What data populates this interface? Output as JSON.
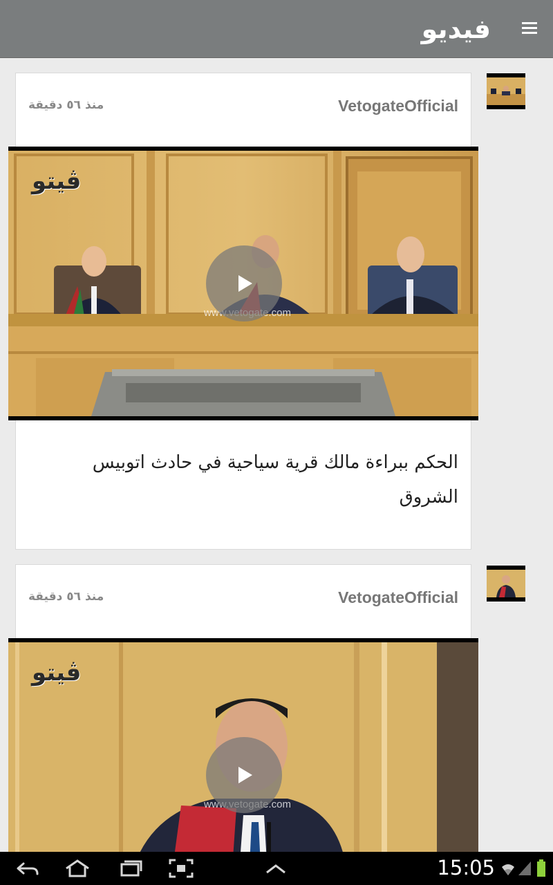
{
  "appbar": {
    "title": "فيديو",
    "menu_icon": "hamburger-icon"
  },
  "feed": {
    "items": [
      {
        "author": "VetogateOfficial",
        "time": "منذ ٥٦ دقيقة",
        "logo_text": "ڤيتو",
        "watermark": "www.vetogate.com",
        "caption_lines": [
          "الحكم ببراءة مالك قرية سياحية في حادث اتوبيس",
          "الشروق"
        ]
      },
      {
        "author": "VetogateOfficial",
        "time": "منذ ٥٦ دقيقة",
        "logo_text": "ڤيتو",
        "watermark": "www.vetogate.com",
        "caption_lines": []
      }
    ]
  },
  "system_bar": {
    "clock": "15:05",
    "icons": [
      "back-icon",
      "home-icon",
      "recent-apps-icon",
      "screenshot-icon",
      "up-chevron-icon",
      "wifi-icon",
      "signal-icon",
      "battery-icon"
    ]
  },
  "colors": {
    "appbar": "#7a7d7e",
    "background": "#ebebeb",
    "card": "#ffffff",
    "text_secondary": "#777777",
    "battery": "#8ed13b"
  }
}
